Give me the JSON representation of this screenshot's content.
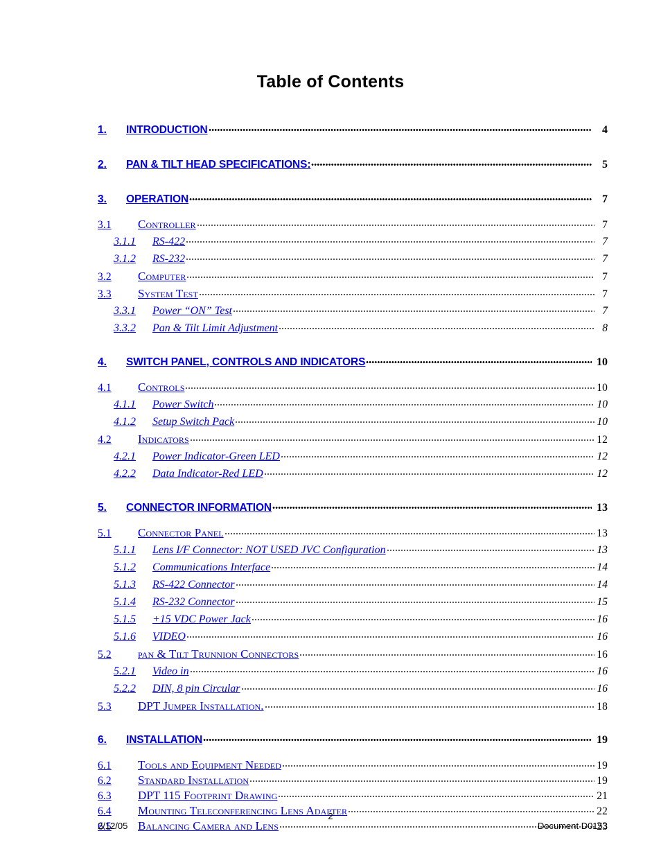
{
  "document": {
    "title": "Table of Contents"
  },
  "toc": {
    "entries": [
      {
        "level": 1,
        "number": "1.",
        "label": "INTRODUCTION",
        "page": "4"
      },
      {
        "level": 1,
        "number": "2.",
        "label": "PAN & TILT HEAD SPECIFICATIONS:",
        "page": "5"
      },
      {
        "level": 1,
        "number": "3.",
        "label": "OPERATION",
        "page": "7"
      },
      {
        "level": 2,
        "number": "3.1",
        "label": "Controller",
        "page": "7"
      },
      {
        "level": 3,
        "number": "3.1.1",
        "label": "RS-422",
        "page": "7"
      },
      {
        "level": 3,
        "number": "3.1.2",
        "label": "RS-232",
        "page": "7"
      },
      {
        "level": 2,
        "number": "3.2",
        "label": "Computer",
        "page": "7"
      },
      {
        "level": 2,
        "number": "3.3",
        "label": "System Test",
        "page": "7"
      },
      {
        "level": 3,
        "number": "3.3.1",
        "label": "Power “ON” Test",
        "page": "7"
      },
      {
        "level": 3,
        "number": "3.3.2",
        "label": "Pan & Tilt Limit Adjustment",
        "page": "8"
      },
      {
        "level": 1,
        "number": "4.",
        "label": "SWITCH PANEL, CONTROLS AND INDICATORS",
        "page": "10"
      },
      {
        "level": 2,
        "number": "4.1",
        "label": "Controls",
        "page": "10"
      },
      {
        "level": 3,
        "number": "4.1.1",
        "label": "Power Switch",
        "page": "10"
      },
      {
        "level": 3,
        "number": "4.1.2",
        "label": "Setup Switch Pack",
        "page": "10"
      },
      {
        "level": 2,
        "number": "4.2",
        "label": "Indicators",
        "page": "12"
      },
      {
        "level": 3,
        "number": "4.2.1",
        "label": "Power Indicator-Green LED",
        "page": "12"
      },
      {
        "level": 3,
        "number": "4.2.2",
        "label": "Data Indicator-Red LED",
        "page": "12"
      },
      {
        "level": 1,
        "number": "5.",
        "label": "CONNECTOR INFORMATION",
        "page": "13"
      },
      {
        "level": 2,
        "number": "5.1",
        "label": "Connector Panel",
        "page": "13"
      },
      {
        "level": 3,
        "number": "5.1.1",
        "label": "Lens I/F Connector: NOT USED JVC Configuration",
        "page": "13"
      },
      {
        "level": 3,
        "number": "5.1.2",
        "label": "Communications Interface",
        "page": "14"
      },
      {
        "level": 3,
        "number": "5.1.3",
        "label": "RS-422 Connector",
        "page": "14"
      },
      {
        "level": 3,
        "number": "5.1.4",
        "label": "RS-232 Connector",
        "page": "15"
      },
      {
        "level": 3,
        "number": "5.1.5",
        "label": "+15 VDC Power Jack",
        "page": "16"
      },
      {
        "level": 3,
        "number": "5.1.6",
        "label": "VIDEO",
        "page": "16"
      },
      {
        "level": 2,
        "number": "5.2",
        "label": "pan & Tilt Trunnion Connectors",
        "page": "16"
      },
      {
        "level": 3,
        "number": "5.2.1",
        "label": "Video in",
        "page": "16"
      },
      {
        "level": 3,
        "number": "5.2.2",
        "label": "DIN, 8 pin Circular",
        "page": "16"
      },
      {
        "level": 2,
        "number": "5.3",
        "label": "DPT Jumper Installation.",
        "page": "18"
      },
      {
        "level": 1,
        "number": "6.",
        "label": "INSTALLATION",
        "page": "19"
      },
      {
        "level": 2,
        "number": "6.1",
        "label": "Tools and Equipment Needed",
        "page": "19"
      },
      {
        "level": 2,
        "number": "6.2",
        "label": " Standard Installation",
        "page": "19"
      },
      {
        "level": 2,
        "number": "6.3",
        "label": "DPT 115 Footprint Drawing",
        "page": "21"
      },
      {
        "level": 2,
        "number": "6.4",
        "label": "Mounting Teleconferencing Lens Adapter",
        "page": "22"
      },
      {
        "level": 2,
        "number": "6.5",
        "label": "Balancing Camera and Lens",
        "page": "23"
      }
    ]
  },
  "footer": {
    "date": "2/12/05",
    "page_number": "2",
    "document_id": "Document D0153"
  },
  "colors": {
    "link": "#0000e0",
    "text": "#000000",
    "background": "#ffffff"
  }
}
